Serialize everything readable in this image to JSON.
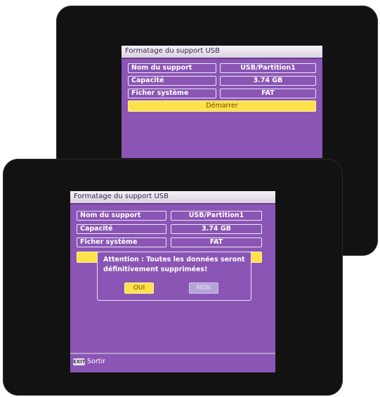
{
  "screen_back": {
    "title": "Formatage du support USB",
    "rows": [
      {
        "label": "Nom du support",
        "value": "USB/Partition1"
      },
      {
        "label": "Capacité",
        "value": "3.74 GB"
      },
      {
        "label": "Ficher système",
        "value": "FAT"
      }
    ],
    "start_button": "Démarrer"
  },
  "screen_front": {
    "title": "Formatage du support USB",
    "rows": [
      {
        "label": "Nom du support",
        "value": "USB/Partition1"
      },
      {
        "label": "Capacité",
        "value": "3.74 GB"
      },
      {
        "label": "Ficher système",
        "value": "FAT"
      }
    ],
    "dialog": {
      "message": "Attention : Toutes les données seront définitivement supprimées!",
      "yes": "OUI",
      "no": "NON"
    },
    "footer": {
      "exit_key": "EXIT",
      "exit_label": "Sortir"
    }
  },
  "colors": {
    "panel": "#8a55b4",
    "highlight": "#ffe14a",
    "tv_bezel": "#121212"
  }
}
